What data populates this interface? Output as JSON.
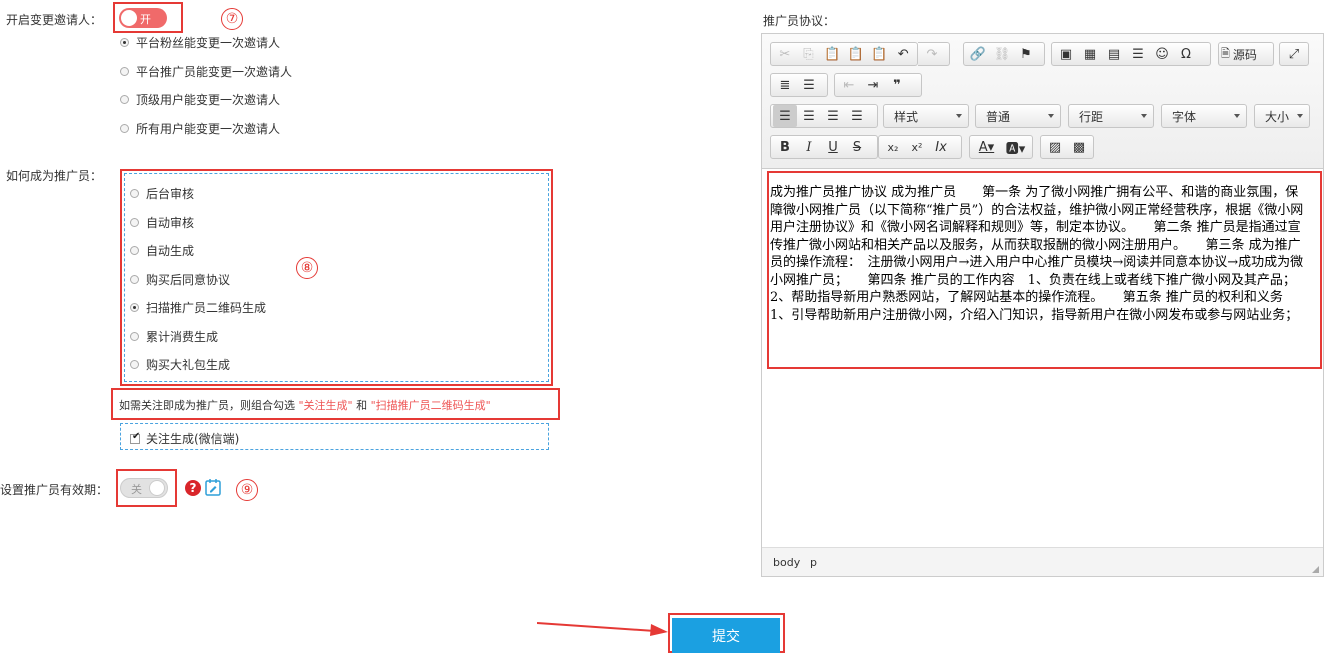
{
  "form": {
    "invite_label": "开启变更邀请人：",
    "invite_toggle_text": "开",
    "invite_options": [
      {
        "label": "平台粉丝能变更一次邀请人",
        "checked": true
      },
      {
        "label": "平台推广员能变更一次邀请人",
        "checked": false
      },
      {
        "label": "顶级用户能变更一次邀请人",
        "checked": false
      },
      {
        "label": "所有用户能变更一次邀请人",
        "checked": false
      }
    ],
    "become_label": "如何成为推广员：",
    "become_options": [
      {
        "label": "后台审核",
        "checked": false
      },
      {
        "label": "自动审核",
        "checked": false
      },
      {
        "label": "自动生成",
        "checked": false
      },
      {
        "label": "购买后同意协议",
        "checked": false
      },
      {
        "label": "扫描推广员二维码生成",
        "checked": true
      },
      {
        "label": "累计消费生成",
        "checked": false
      },
      {
        "label": "购买大礼包生成",
        "checked": false
      }
    ],
    "hint_prefix": "如需关注即成为推广员，则组合勾选",
    "hint_opt1": "\"关注生成\"",
    "hint_and": "和",
    "hint_opt2": "\"扫描推广员二维码生成\"",
    "follow_checkbox_label": "关注生成(微信端)",
    "validity_label": "设置推广员有效期：",
    "validity_toggle_text": "关"
  },
  "annotations": {
    "n7": "⑦",
    "n8": "⑧",
    "n9": "⑨"
  },
  "editor": {
    "label": "推广员协议：",
    "combos": {
      "style": "样式",
      "para": "普通",
      "spacing": "行距",
      "font": "字体",
      "size": "大小"
    },
    "source_label": "源码",
    "content": "成为推广员推广协议 成为推广员　　第一条 为了微小网推广拥有公平、和谐的商业氛围，保障微小网推广员（以下简称“推广员”）的合法权益，维护微小网正常经营秩序，根据《微小网用户注册协议》和《微小网名词解释和规则》等，制定本协议。　　第二条 推广员是指通过宣传推广微小网站和相关产品以及服务，从而获取报酬的微小网注册用户。　　第三条 成为推广员的操作流程：　注册微小网用户→进入用户中心推广员模块→阅读并同意本协议→成功成为微小网推广员；　　第四条 推广员的工作内容　1、负责在线上或者线下推广微小网及其产品；　2、帮助指导新用户熟悉网站，了解网站基本的操作流程。　　第五条 推广员的权利和义务　1、引导帮助新用户注册微小网，介绍入门知识，指导新用户在微小网发布或参与网站业务；",
    "status_body": "body",
    "status_p": "p"
  },
  "submit_label": "提交",
  "colors": {
    "accent_red": "#e53935",
    "toggle_on": "#f06a6a",
    "submit_blue": "#1ba0e1",
    "hint_red": "#e55"
  }
}
